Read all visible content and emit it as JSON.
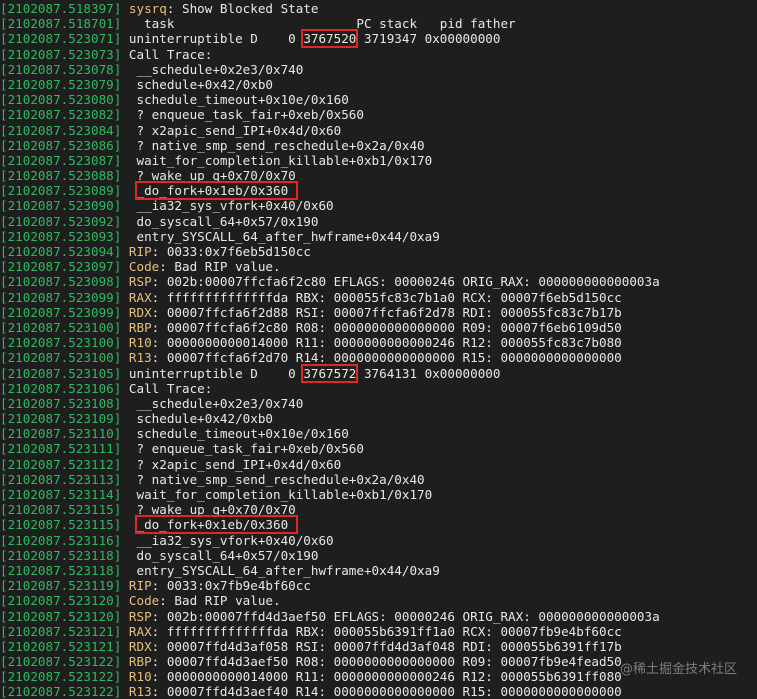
{
  "terminal": {
    "lines": [
      {
        "ts": "2102087.518397",
        "parts": [
          {
            "t": "sysrq",
            "c": "key"
          },
          {
            "t": ": Show Blocked State",
            "c": "txt"
          }
        ]
      },
      {
        "ts": "2102087.518701",
        "parts": [
          {
            "t": "  task                        PC stack   pid father",
            "c": "txt"
          }
        ]
      },
      {
        "ts": "2102087.523071",
        "parts": [
          {
            "t": "uninterruptible D    0 ",
            "c": "txt"
          },
          {
            "t": "3767520",
            "c": "txt",
            "box": true
          },
          {
            "t": " 3719347 0x00000000",
            "c": "txt"
          }
        ]
      },
      {
        "ts": "2102087.523073",
        "parts": [
          {
            "t": "Call Trace:",
            "c": "txt"
          }
        ]
      },
      {
        "ts": "2102087.523078",
        "parts": [
          {
            "t": " __schedule+0x2e3/0x740",
            "c": "txt"
          }
        ]
      },
      {
        "ts": "2102087.523079",
        "parts": [
          {
            "t": " schedule+0x42/0xb0",
            "c": "txt"
          }
        ]
      },
      {
        "ts": "2102087.523080",
        "parts": [
          {
            "t": " schedule_timeout+0x10e/0x160",
            "c": "txt"
          }
        ]
      },
      {
        "ts": "2102087.523082",
        "parts": [
          {
            "t": " ? enqueue_task_fair+0xeb/0x560",
            "c": "txt"
          }
        ]
      },
      {
        "ts": "2102087.523084",
        "parts": [
          {
            "t": " ? x2apic_send_IPI+0x4d/0x60",
            "c": "txt"
          }
        ]
      },
      {
        "ts": "2102087.523086",
        "parts": [
          {
            "t": " ? native_smp_send_reschedule+0x2a/0x40",
            "c": "txt"
          }
        ]
      },
      {
        "ts": "2102087.523087",
        "parts": [
          {
            "t": " wait_for_completion_killable+0xb1/0x170",
            "c": "txt"
          }
        ]
      },
      {
        "ts": "2102087.523088",
        "parts": [
          {
            "t": " ? wake_up_q+0x70/0x70",
            "c": "txt"
          }
        ]
      },
      {
        "ts": "2102087.523089",
        "parts": [
          {
            "t": " ",
            "c": "txt"
          },
          {
            "t": "_do_fork+0x1eb/0x360 ",
            "c": "txt",
            "box": true
          }
        ]
      },
      {
        "ts": "2102087.523090",
        "parts": [
          {
            "t": " __ia32_sys_vfork+0x40/0x60",
            "c": "txt"
          }
        ]
      },
      {
        "ts": "2102087.523092",
        "parts": [
          {
            "t": " do_syscall_64+0x57/0x190",
            "c": "txt"
          }
        ]
      },
      {
        "ts": "2102087.523093",
        "parts": [
          {
            "t": " entry_SYSCALL_64_after_hwframe+0x44/0xa9",
            "c": "txt"
          }
        ]
      },
      {
        "ts": "2102087.523094",
        "parts": [
          {
            "t": "RIP",
            "c": "key"
          },
          {
            "t": ": 0033:0x7f6eb5d150cc",
            "c": "txt"
          }
        ]
      },
      {
        "ts": "2102087.523097",
        "parts": [
          {
            "t": "Code",
            "c": "key"
          },
          {
            "t": ": Bad RIP value.",
            "c": "txt"
          }
        ]
      },
      {
        "ts": "2102087.523098",
        "parts": [
          {
            "t": "RSP",
            "c": "key"
          },
          {
            "t": ": 002b:00007ffcfa6f2c80 EFLAGS: 00000246 ORIG_RAX: 000000000000003a",
            "c": "txt"
          }
        ]
      },
      {
        "ts": "2102087.523099",
        "parts": [
          {
            "t": "RAX",
            "c": "key"
          },
          {
            "t": ": ffffffffffffffda RBX: 000055fc83c7b1a0 RCX: 00007f6eb5d150cc",
            "c": "txt"
          }
        ]
      },
      {
        "ts": "2102087.523099",
        "parts": [
          {
            "t": "RDX",
            "c": "key"
          },
          {
            "t": ": 00007ffcfa6f2d88 RSI: 00007ffcfa6f2d78 RDI: 000055fc83c7b17b",
            "c": "txt"
          }
        ]
      },
      {
        "ts": "2102087.523100",
        "parts": [
          {
            "t": "RBP",
            "c": "key"
          },
          {
            "t": ": 00007ffcfa6f2c80 R08: 0000000000000000 R09: 00007f6eb6109d50",
            "c": "txt"
          }
        ]
      },
      {
        "ts": "2102087.523100",
        "parts": [
          {
            "t": "R10",
            "c": "key"
          },
          {
            "t": ": 0000000000014000 R11: 0000000000000246 R12: 000055fc83c7b080",
            "c": "txt"
          }
        ]
      },
      {
        "ts": "2102087.523100",
        "parts": [
          {
            "t": "R13",
            "c": "key"
          },
          {
            "t": ": 00007ffcfa6f2d70 R14: 0000000000000000 R15: 0000000000000000",
            "c": "txt"
          }
        ]
      },
      {
        "ts": "2102087.523105",
        "parts": [
          {
            "t": "uninterruptible D    0 ",
            "c": "txt"
          },
          {
            "t": "3767572",
            "c": "txt",
            "box": true
          },
          {
            "t": " 3764131 0x00000000",
            "c": "txt"
          }
        ]
      },
      {
        "ts": "2102087.523106",
        "parts": [
          {
            "t": "Call Trace:",
            "c": "txt"
          }
        ]
      },
      {
        "ts": "2102087.523108",
        "parts": [
          {
            "t": " __schedule+0x2e3/0x740",
            "c": "txt"
          }
        ]
      },
      {
        "ts": "2102087.523109",
        "parts": [
          {
            "t": " schedule+0x42/0xb0",
            "c": "txt"
          }
        ]
      },
      {
        "ts": "2102087.523110",
        "parts": [
          {
            "t": " schedule_timeout+0x10e/0x160",
            "c": "txt"
          }
        ]
      },
      {
        "ts": "2102087.523111",
        "parts": [
          {
            "t": " ? enqueue_task_fair+0xeb/0x560",
            "c": "txt"
          }
        ]
      },
      {
        "ts": "2102087.523112",
        "parts": [
          {
            "t": " ? x2apic_send_IPI+0x4d/0x60",
            "c": "txt"
          }
        ]
      },
      {
        "ts": "2102087.523113",
        "parts": [
          {
            "t": " ? native_smp_send_reschedule+0x2a/0x40",
            "c": "txt"
          }
        ]
      },
      {
        "ts": "2102087.523114",
        "parts": [
          {
            "t": " wait_for_completion_killable+0xb1/0x170",
            "c": "txt"
          }
        ]
      },
      {
        "ts": "2102087.523115",
        "parts": [
          {
            "t": " ? wake_up_q+0x70/0x70",
            "c": "txt"
          }
        ]
      },
      {
        "ts": "2102087.523115",
        "parts": [
          {
            "t": " ",
            "c": "txt"
          },
          {
            "t": "_do_fork+0x1eb/0x360 ",
            "c": "txt",
            "box": true
          }
        ]
      },
      {
        "ts": "2102087.523116",
        "parts": [
          {
            "t": " __ia32_sys_vfork+0x40/0x60",
            "c": "txt"
          }
        ]
      },
      {
        "ts": "2102087.523118",
        "parts": [
          {
            "t": " do_syscall_64+0x57/0x190",
            "c": "txt"
          }
        ]
      },
      {
        "ts": "2102087.523118",
        "parts": [
          {
            "t": " entry_SYSCALL_64_after_hwframe+0x44/0xa9",
            "c": "txt"
          }
        ]
      },
      {
        "ts": "2102087.523119",
        "parts": [
          {
            "t": "RIP",
            "c": "key"
          },
          {
            "t": ": 0033:0x7fb9e4bf60cc",
            "c": "txt"
          }
        ]
      },
      {
        "ts": "2102087.523120",
        "parts": [
          {
            "t": "Code",
            "c": "key"
          },
          {
            "t": ": Bad RIP value.",
            "c": "txt"
          }
        ]
      },
      {
        "ts": "2102087.523120",
        "parts": [
          {
            "t": "RSP",
            "c": "key"
          },
          {
            "t": ": 002b:00007ffd4d3aef50 EFLAGS: 00000246 ORIG_RAX: 000000000000003a",
            "c": "txt"
          }
        ]
      },
      {
        "ts": "2102087.523121",
        "parts": [
          {
            "t": "RAX",
            "c": "key"
          },
          {
            "t": ": ffffffffffffffda RBX: 000055b6391ff1a0 RCX: 00007fb9e4bf60cc",
            "c": "txt"
          }
        ]
      },
      {
        "ts": "2102087.523121",
        "parts": [
          {
            "t": "RDX",
            "c": "key"
          },
          {
            "t": ": 00007ffd4d3af058 RSI: 00007ffd4d3af048 RDI: 000055b6391ff17b",
            "c": "txt"
          }
        ]
      },
      {
        "ts": "2102087.523122",
        "parts": [
          {
            "t": "RBP",
            "c": "key"
          },
          {
            "t": ": 00007ffd4d3aef50 R08: 0000000000000000 R09: 00007fb9e4fead50",
            "c": "txt"
          }
        ]
      },
      {
        "ts": "2102087.523122",
        "parts": [
          {
            "t": "R10",
            "c": "key"
          },
          {
            "t": ": 0000000000014000 R11: 0000000000000246 R12: 000055b6391ff080",
            "c": "txt"
          }
        ]
      },
      {
        "ts": "2102087.523122",
        "parts": [
          {
            "t": "R13",
            "c": "key"
          },
          {
            "t": ": 00007ffd4d3aef40 R14: 0000000000000000 R15: 0000000000000000",
            "c": "txt"
          }
        ]
      }
    ]
  },
  "watermark": "@稀土掘金技术社区",
  "colors": {
    "background": "#1e1e1e",
    "timestamp": "#2dbb5f",
    "register_key": "#e5c07b",
    "text": "#e8e8e8",
    "highlight_box": "#e0262a"
  }
}
